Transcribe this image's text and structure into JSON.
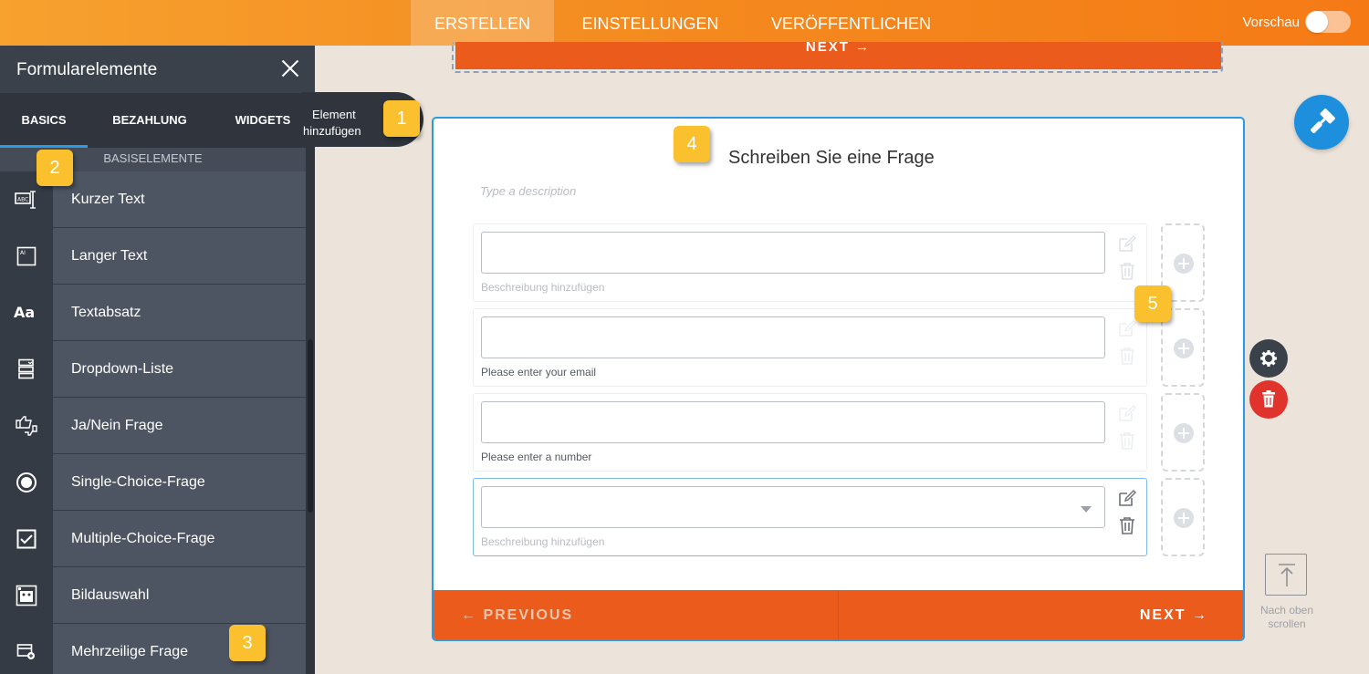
{
  "topbar": {
    "tabs": [
      {
        "label": "ERSTELLEN",
        "active": true
      },
      {
        "label": "EINSTELLUNGEN",
        "active": false
      },
      {
        "label": "VERÖFFENTLICHEN",
        "active": false
      }
    ],
    "preview_label": "Vorschau",
    "preview_enabled": false
  },
  "sidebar": {
    "title": "Formularelemente",
    "tabs": [
      "BASICS",
      "BEZAHLUNG",
      "WIDGETS"
    ],
    "section_label": "BASISELEMENTE",
    "items": [
      {
        "label": "Kurzer Text",
        "icon": "short-text-icon"
      },
      {
        "label": "Langer Text",
        "icon": "long-text-icon"
      },
      {
        "label": "Textabsatz",
        "icon": "paragraph-icon"
      },
      {
        "label": "Dropdown-Liste",
        "icon": "dropdown-icon"
      },
      {
        "label": "Ja/Nein Frage",
        "icon": "thumbs-icon"
      },
      {
        "label": "Single-Choice-Frage",
        "icon": "radio-icon"
      },
      {
        "label": "Multiple-Choice-Frage",
        "icon": "checkbox-icon"
      },
      {
        "label": "Bildauswahl",
        "icon": "image-choice-icon"
      },
      {
        "label": "Mehrzeilige Frage",
        "icon": "multi-line-icon"
      }
    ]
  },
  "add_element_tip": {
    "line1": "Element",
    "line2": "hinzufügen"
  },
  "badges": [
    "1",
    "2",
    "3",
    "4",
    "5"
  ],
  "form": {
    "top_next_label": "NEXT →",
    "question_title": "Schreiben Sie eine Frage",
    "description_placeholder": "Type a description",
    "fields": [
      {
        "type": "text",
        "caption": "Beschreibung hinzufügen",
        "caption_is_placeholder": true
      },
      {
        "type": "text",
        "caption": "Please enter your email",
        "caption_is_placeholder": false
      },
      {
        "type": "text",
        "caption": "Please enter a number",
        "caption_is_placeholder": false
      },
      {
        "type": "dropdown",
        "caption": "Beschreibung hinzufügen",
        "caption_is_placeholder": true
      }
    ],
    "previous_label": "← PREVIOUS",
    "next_label": "NEXT →"
  },
  "scroll_top": {
    "line1": "Nach oben",
    "line2": "scrollen"
  },
  "colors": {
    "accent_orange": "#ea5b1c",
    "accent_blue": "#2a9ae3",
    "badge_yellow": "#fbc02d",
    "delete_red": "#e0332b"
  }
}
